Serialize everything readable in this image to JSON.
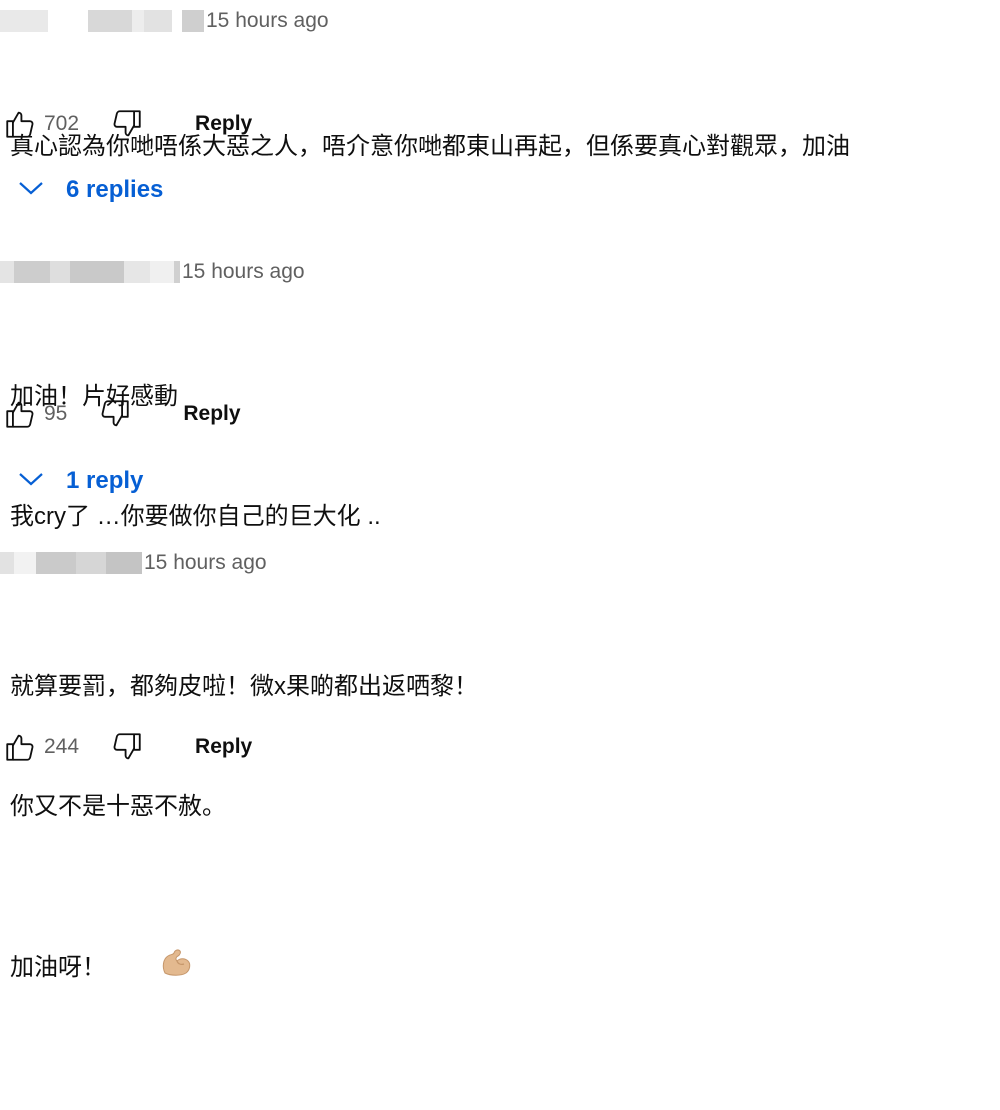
{
  "comments": [
    {
      "author_redacted": true,
      "time": "15 hours ago",
      "lines": [
        "真心認為你哋唔係大惡之人，唔介意你哋都東山再起，但係要真心對觀眾，加油"
      ],
      "likes": "702",
      "reply_label": "Reply",
      "replies_label": "6 replies"
    },
    {
      "author_redacted": true,
      "time": "15 hours ago",
      "lines": [
        "加油！片好感動",
        "我cry了 …你要做你自己的巨大化 .."
      ],
      "likes": "95",
      "reply_label": "Reply",
      "replies_label": "1 reply"
    },
    {
      "author_redacted": true,
      "time": "15 hours ago",
      "lines": [
        "就算要罰，都夠皮啦！微x果啲都出返哂黎！",
        "你又不是十惡不赦。",
        "加油呀！"
      ],
      "emoji": "flexed-biceps",
      "likes": "244",
      "reply_label": "Reply"
    }
  ],
  "icons": {
    "like": "thumbs-up-icon",
    "dislike": "thumbs-down-icon",
    "expand": "chevron-down-icon"
  },
  "colors": {
    "link": "#065fd4",
    "secondary_text": "#606060",
    "text": "#0f0f0f"
  }
}
